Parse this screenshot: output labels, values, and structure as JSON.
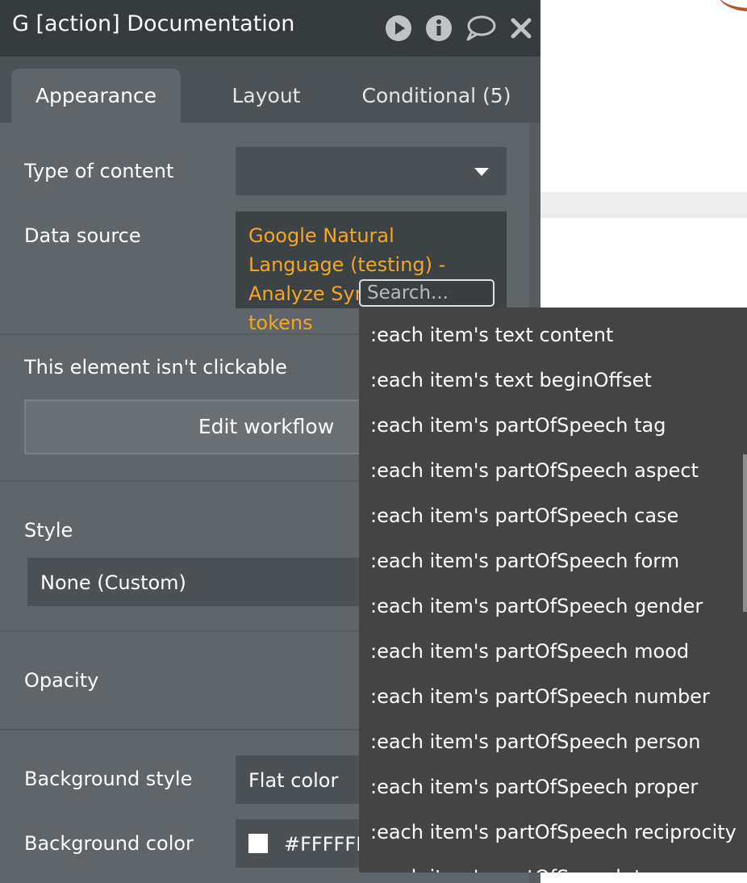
{
  "window": {
    "title": "G [action] Documentation",
    "icons": [
      "play-icon",
      "info-icon",
      "comment-icon",
      "close-icon"
    ]
  },
  "tabs": [
    {
      "label": "Appearance",
      "active": true
    },
    {
      "label": "Layout",
      "active": false
    },
    {
      "label": "Conditional (5)",
      "active": false
    }
  ],
  "properties": {
    "type_of_content": {
      "label": "Type of content",
      "value": ""
    },
    "data_source": {
      "label": "Data source",
      "value": "Google Natural Language (testing) - Analyze Syntax's body tokens",
      "search_placeholder": "Search..."
    },
    "clickable_note": "This element isn't clickable",
    "edit_workflow_label": "Edit workflow",
    "style": {
      "label": "Style",
      "value": "None (Custom)"
    },
    "opacity": {
      "label": "Opacity"
    },
    "background_style": {
      "label": "Background style",
      "value": "Flat color"
    },
    "background_color": {
      "label": "Background color",
      "value": "#FFFFFF"
    }
  },
  "dropdown": {
    "items": [
      ":each item's text content",
      ":each item's text beginOffset",
      ":each item's partOfSpeech tag",
      ":each item's partOfSpeech aspect",
      ":each item's partOfSpeech case",
      ":each item's partOfSpeech form",
      ":each item's partOfSpeech gender",
      ":each item's partOfSpeech mood",
      ":each item's partOfSpeech number",
      ":each item's partOfSpeech person",
      ":each item's partOfSpeech proper",
      ":each item's partOfSpeech reciprocity",
      ":each item's partOfSpeech tense"
    ]
  },
  "colors": {
    "accent": "#F5A623",
    "panel_bg": "#5F6569",
    "titlebar_bg": "#363B3E",
    "dropdown_bg": "#444444"
  }
}
